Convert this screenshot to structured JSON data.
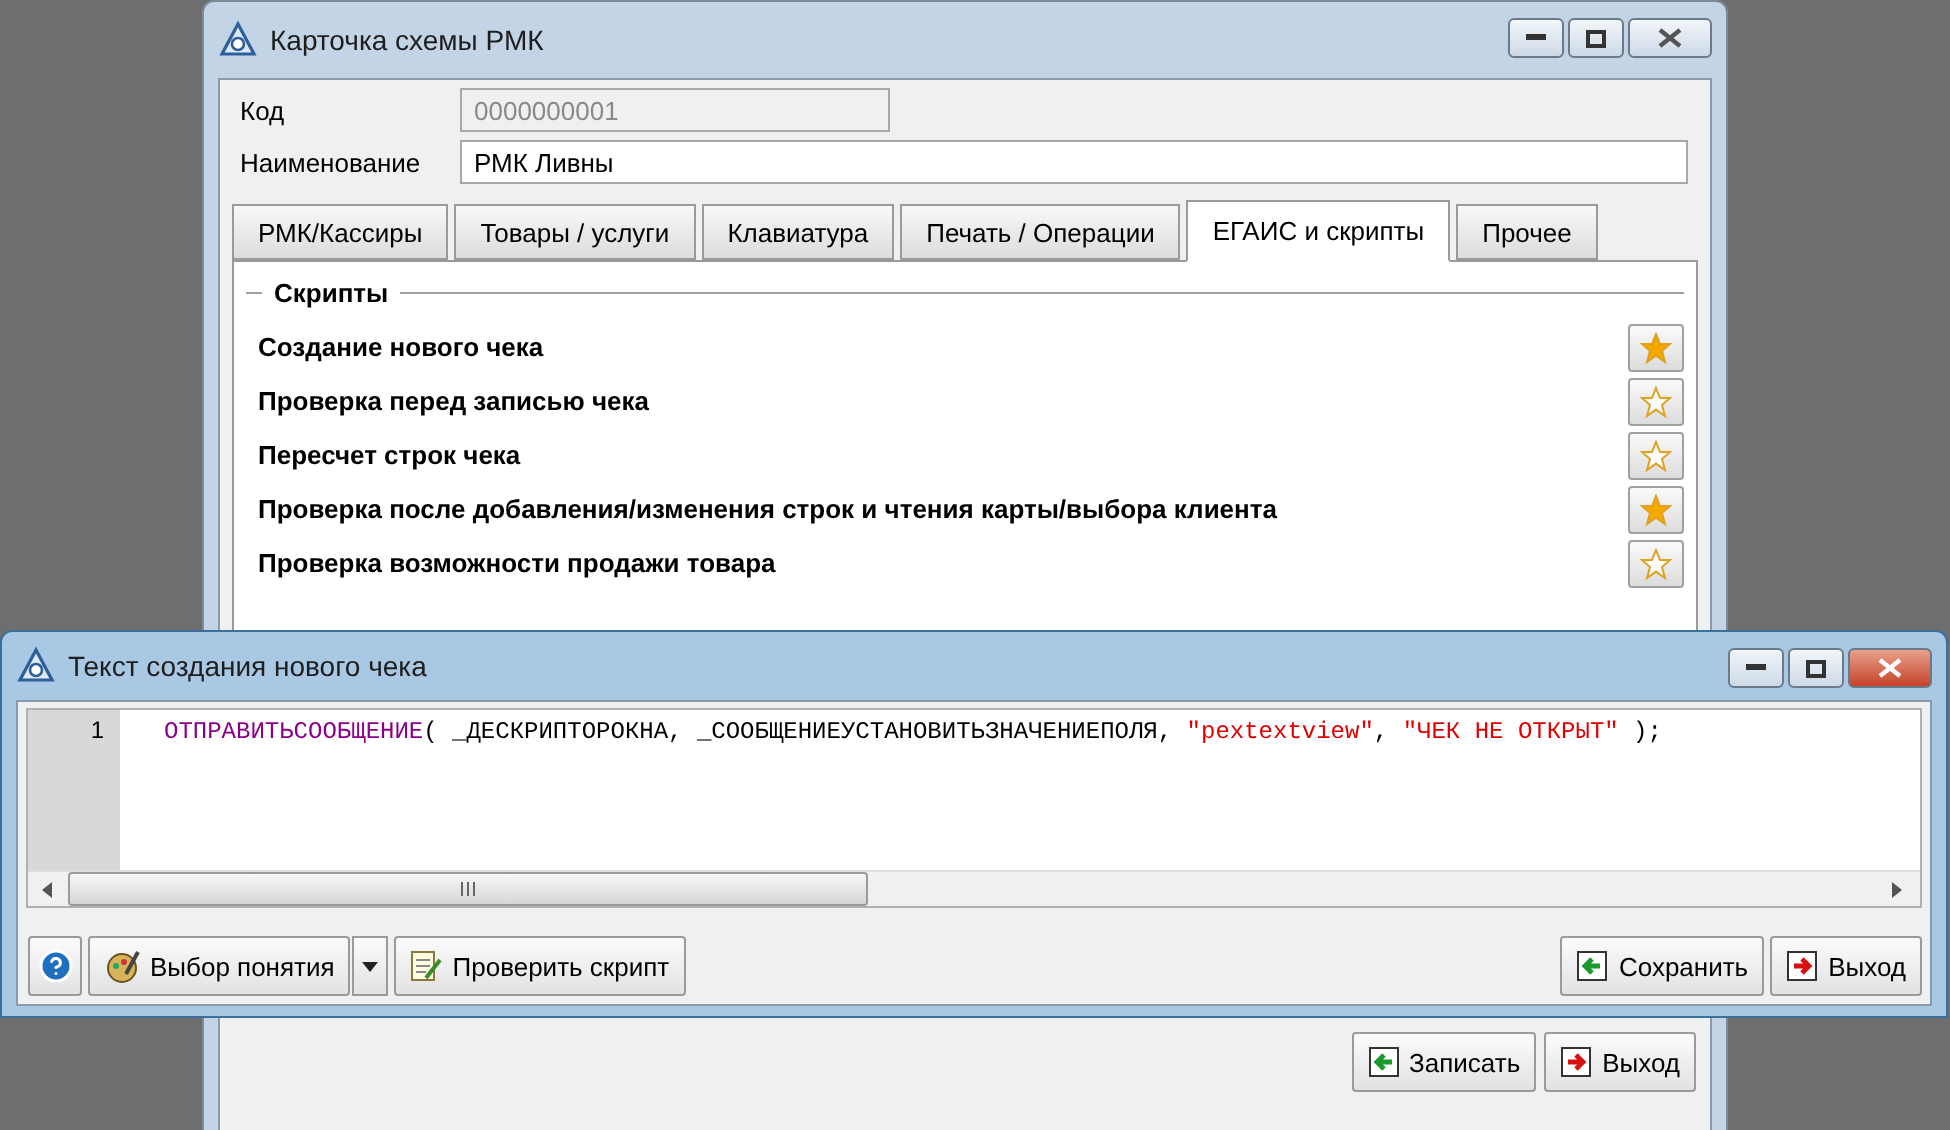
{
  "card_window": {
    "title": "Карточка схемы РМК",
    "active": false,
    "fields": [
      {
        "label": "Код",
        "value": "0000000001",
        "disabled": true
      },
      {
        "label": "Наименование",
        "value": "РМК Ливны",
        "disabled": false
      }
    ],
    "tabs": [
      {
        "label": "РМК/Кассиры",
        "selected": false
      },
      {
        "label": "Товары / услуги",
        "selected": false
      },
      {
        "label": "Клавиатура",
        "selected": false
      },
      {
        "label": "Печать / Операции",
        "selected": false
      },
      {
        "label": "ЕГАИС и скрипты",
        "selected": true
      },
      {
        "label": "Прочее",
        "selected": false
      }
    ],
    "group_title": "Скрипты",
    "scripts": [
      {
        "label": "Создание нового чека",
        "starred": true
      },
      {
        "label": "Проверка перед записью чека",
        "starred": false
      },
      {
        "label": "Пересчет строк чека",
        "starred": false
      },
      {
        "label": "Проверка после добавления/изменения строк и чтения карты/выбора клиента",
        "starred": true
      },
      {
        "label": "Проверка возможности продажи товара",
        "starred": false
      }
    ],
    "buttons": [
      {
        "label": "Записать",
        "kind": "save"
      },
      {
        "label": "Выход",
        "kind": "exit"
      }
    ]
  },
  "editor_window": {
    "title": "Текст создания нового чека",
    "active": true,
    "lines": [
      {
        "number": "1",
        "tokens": [
          {
            "text": "ОТПРАВИТЬСООБЩЕНИЕ",
            "kind": "keyword"
          },
          {
            "text": "( _ДЕСКРИПТОРОКНА, _СООБЩЕНИЕУСТАНОВИТЬЗНАЧЕНИЕПОЛЯ, ",
            "kind": "plain"
          },
          {
            "text": "\"pextextview\"",
            "kind": "string"
          },
          {
            "text": ", ",
            "kind": "plain"
          },
          {
            "text": "\"ЧЕК НЕ ОТКРЫТ\"",
            "kind": "string"
          },
          {
            "text": " );",
            "kind": "plain"
          }
        ]
      }
    ],
    "left_buttons": [
      {
        "label": "Выбор понятия",
        "kind": "concept"
      },
      {
        "label": "Проверить скрипт",
        "kind": "check"
      }
    ],
    "right_buttons": [
      {
        "label": "Сохранить",
        "kind": "save"
      },
      {
        "label": "Выход",
        "kind": "exit"
      }
    ]
  }
}
